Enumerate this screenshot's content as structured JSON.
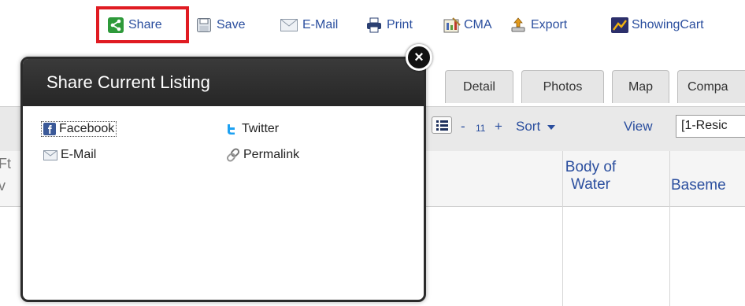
{
  "toolbar": {
    "share": "Share",
    "save": "Save",
    "email": "E-Mail",
    "print": "Print",
    "cma": "CMA",
    "export": "Export",
    "showingcart": "ShowingCart"
  },
  "tabs": [
    "Detail",
    "Photos",
    "Map",
    "Compa"
  ],
  "view_bar": {
    "minus": "-",
    "page_size": "11",
    "plus": "+",
    "sort": "Sort",
    "view": "View",
    "view_select": "[1-Resic"
  },
  "columns": {
    "body_of_water": "Body of Water",
    "basement": "Baseme"
  },
  "left_fragments": [
    "Ft",
    "v"
  ],
  "popup": {
    "title": "Share Current Listing",
    "close": "×",
    "links": {
      "facebook": "Facebook",
      "twitter": "Twitter",
      "email": "E-Mail",
      "permalink": "Permalink"
    }
  },
  "colors": {
    "link_blue": "#2a4e9e",
    "highlight_red": "#e01b22",
    "popup_header": "#2b2b2b",
    "share_green": "#2e9a3a"
  }
}
